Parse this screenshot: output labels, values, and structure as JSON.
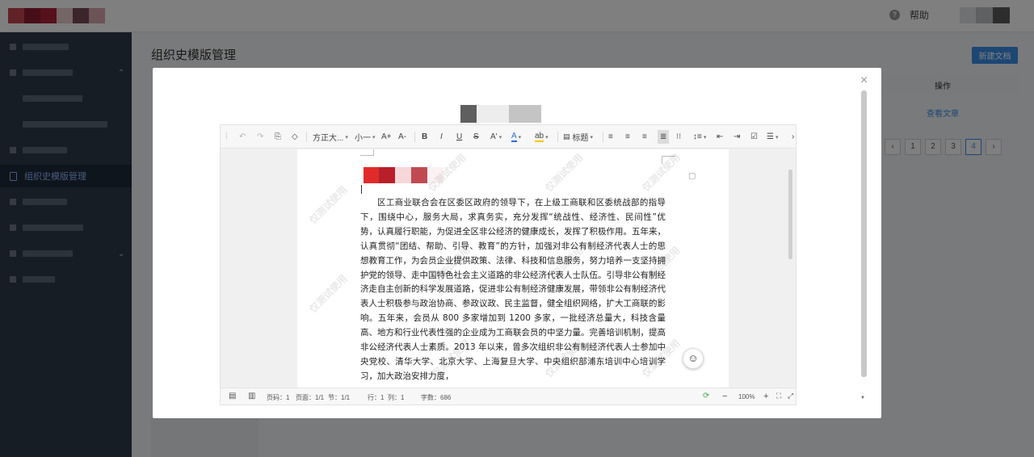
{
  "header": {
    "help_label": "帮助",
    "logo_colors": [
      "#c2464f",
      "#8f1d33",
      "#ad2238",
      "#e8cacd",
      "#7a4a58",
      "#d8a6ad"
    ],
    "user_colors": [
      "#e1e2e6",
      "#bfc0c5",
      "#5a5a5a"
    ]
  },
  "sidebar": {
    "active_label": "组织史模版管理",
    "active_icon": "document-icon"
  },
  "main": {
    "page_title": "组织史模版管理",
    "new_button": "新建文档",
    "col_operation": "操作",
    "view_link": "查看文章",
    "pagination": [
      "1",
      "2",
      "3",
      "4"
    ],
    "current_page": "4",
    "pagination_prev": "‹",
    "pagination_next": "›"
  },
  "modal": {
    "close_icon": "×",
    "header_colors": [
      "#5f5f5f",
      "#ededed",
      "#c4c4c4"
    ],
    "toolbar": {
      "undo": "↶",
      "redo": "↷",
      "format_painter": "⎘",
      "clear_format": "◇",
      "font_family": "方正大...",
      "font_size": "小一",
      "grow_font": "A+",
      "shrink_font": "A-",
      "bold": "B",
      "italic": "I",
      "underline": "U",
      "strike": "S",
      "text_effect": "A'",
      "font_color": "A",
      "highlight": "ab",
      "heading": "标题",
      "more": "›"
    },
    "doc": {
      "title_colors": [
        "#e12a2a",
        "#b81f2a",
        "#f6d7da",
        "#c14a52",
        "#fbf1f2"
      ],
      "body": "区工商业联合会在区委区政府的领导下，在上级工商联和区委统战部的指导下，围绕中心，服务大局，求真务实，充分发挥“统战性、经济性、民间性”优势，认真履行职能，为促进全区非公经济的健康成长，发挥了积极作用。五年来，认真贯彻“团结、帮助、引导、教育”的方针，加强对非公有制经济代表人士的思想教育工作，为会员企业提供政策、法律、科技和信息服务，努力培养一支坚持拥护党的领导、走中国特色社会主义道路的非公经济代表人士队伍。引导非公有制经济走自主创新的科学发展道路，促进非公有制经济健康发展，带领非公有制经济代表人士积极参与政治协商、参政议政、民主监督，健全组织网络，扩大工商联的影响。五年来，会员从 800 多家增加到 1200 多家，一批经济总量大，科技含量高、地方和行业代表性强的企业成为工商联会员的中坚力量。完善培训机制，提高非公经济代表人士素质。2013 年以来，曾多次组织非公有制经济代表人士参加中央党校、清华大学、北京大学、上海复旦大学、中央组织部浦东培训中心培训学习，加大政治安排力度，",
      "watermark": "仅测试使用"
    },
    "status": {
      "page_code": "页码：1",
      "page_of": "页面：1/1",
      "section": "节：1/1",
      "row": "行：1",
      "col": "列：1",
      "word_count": "字数：686",
      "zoom": "100%",
      "zoom_minus": "−",
      "zoom_plus": "+"
    }
  }
}
